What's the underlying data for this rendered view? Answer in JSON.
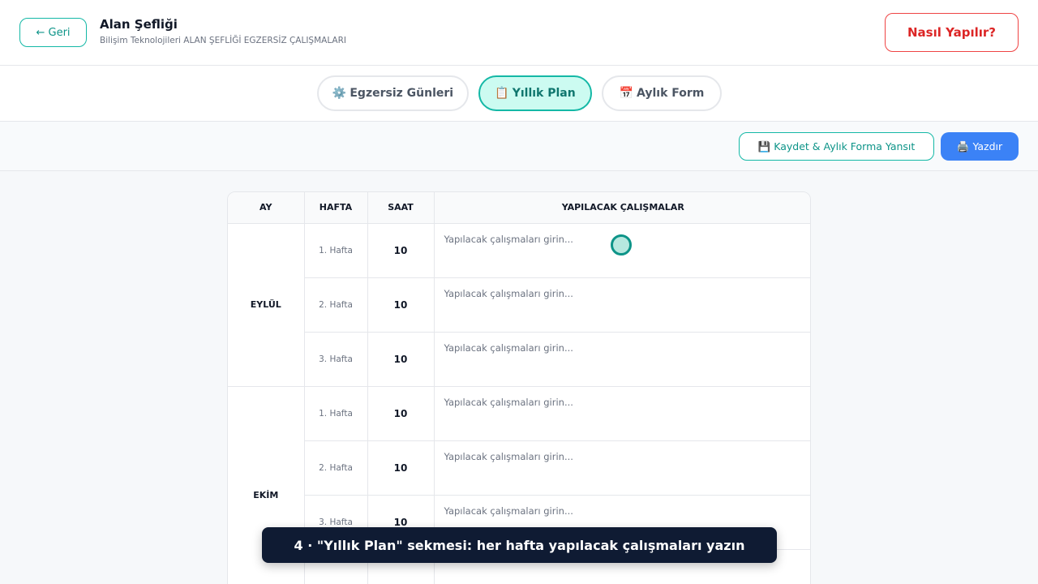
{
  "header": {
    "back_label": "← Geri",
    "title": "Alan Şefliği",
    "subtitle": "Bilişim Teknolojileri ALAN ŞEFLİĞİ EGZERSİZ ÇALIŞMALARI",
    "howto_label": "Nasıl Yapılır?"
  },
  "tabs": [
    {
      "icon": "⚙️",
      "label": "Egzersiz Günleri",
      "active": false
    },
    {
      "icon": "📋",
      "label": "Yıllık Plan",
      "active": true
    },
    {
      "icon": "📅",
      "label": "Aylık Form",
      "active": false
    }
  ],
  "actions": {
    "save_icon": "💾",
    "save_label": "Kaydet & Aylık Forma Yansıt",
    "print_icon": "🖨️",
    "print_label": "Yazdır"
  },
  "table": {
    "columns": [
      "AY",
      "HAFTA",
      "SAAT",
      "YAPILACAK ÇALIŞMALAR"
    ],
    "placeholder": "Yapılacak çalışmaları girin...",
    "months": [
      {
        "name": "EYLÜL",
        "weeks": [
          {
            "week": "1. Hafta",
            "hours": "10",
            "value": ""
          },
          {
            "week": "2. Hafta",
            "hours": "10",
            "value": ""
          },
          {
            "week": "3. Hafta",
            "hours": "10",
            "value": ""
          }
        ]
      },
      {
        "name": "EKİM",
        "weeks": [
          {
            "week": "1. Hafta",
            "hours": "10",
            "value": ""
          },
          {
            "week": "2. Hafta",
            "hours": "10",
            "value": ""
          },
          {
            "week": "3. Hafta",
            "hours": "10",
            "value": ""
          },
          {
            "week": "",
            "hours": "",
            "value": ""
          }
        ]
      }
    ]
  },
  "caption": "4 · \"Yıllık Plan\" sekmesi: her hafta yapılacak çalışmaları yazın"
}
